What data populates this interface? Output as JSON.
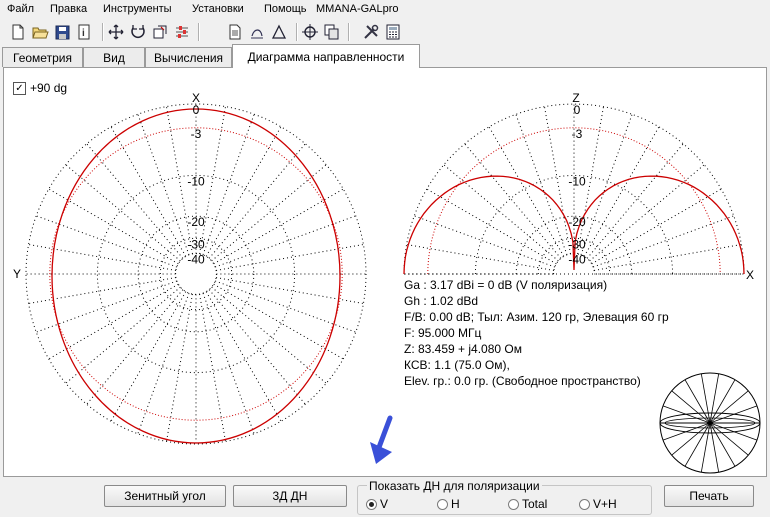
{
  "menu": [
    "Файл",
    "Правка",
    "Инструменты",
    "Установки",
    "Помощь",
    "MMANA-GALpro"
  ],
  "toolbar": [
    "new-file-icon",
    "open-folder-icon",
    "save-icon",
    "info-icon",
    "move-icon",
    "rotate-icon",
    "clone-icon",
    "sliders-icon",
    "document-icon",
    "pencil-icon",
    "triangle-icon",
    "crosshair-icon",
    "copy-icon",
    "tools-icon",
    "calculator-icon"
  ],
  "tabs": [
    "Геометрия",
    "Вид",
    "Вычисления",
    "Диаграмма направленности"
  ],
  "active_tab": 3,
  "checkbox": {
    "label": "+90 dg",
    "checked": true
  },
  "left_plot": {
    "top_axis": "X",
    "left_axis": "Y",
    "rings": [
      "0",
      "-3",
      "-10",
      "-20",
      "-30",
      "-40"
    ]
  },
  "right_plot": {
    "top_axis": "Z",
    "right_axis": "X",
    "rings": [
      "0",
      "-3",
      "-10",
      "-20",
      "-30",
      "-40"
    ]
  },
  "info": [
    "Ga : 3.17 dBi = 0 dB  (V поляризация)",
    "Gh : 1.02 dBd",
    "F/B: 0.00 dB; Тыл: Азим. 120 гр, Элевация 60 гр",
    "F: 95.000 МГц",
    "Z: 83.459 + j4.080 Ом",
    "КСВ: 1.1 (75.0 Ом),",
    "Elev. гр.: 0.0 гр. (Свободное пространство)"
  ],
  "buttons": {
    "zenith": "Зенитный угол",
    "three_d": "3Д   ДН",
    "print": "Печать"
  },
  "polarization": {
    "title": "Показать ДН для поляризации",
    "options": [
      "V",
      "H",
      "Total",
      "V+H"
    ],
    "selected": "V"
  },
  "colors": {
    "pattern": "#cc0000",
    "arrow": "#3a50d8"
  }
}
